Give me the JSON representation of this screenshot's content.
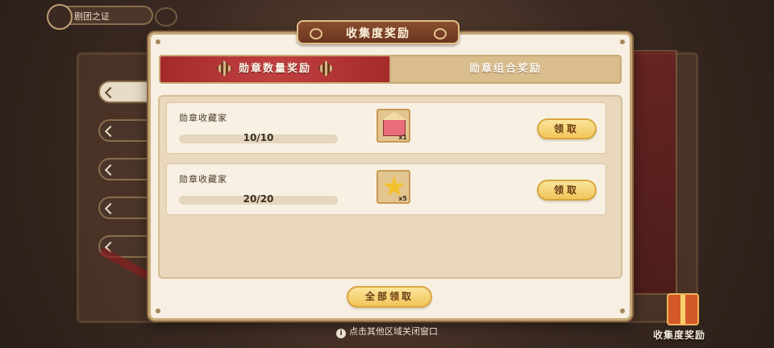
{
  "background": {
    "top_label": "剧团之证",
    "corner_reward_label": "收集度奖励",
    "hint": "点击其他区域关闭窗口"
  },
  "modal": {
    "title": "收集度奖励",
    "tabs": [
      {
        "label": "勋章数量奖励",
        "active": true
      },
      {
        "label": "勋章组合奖励",
        "active": false
      }
    ],
    "rows": [
      {
        "name": "勋章收藏家",
        "progress_text": "10/10",
        "progress_fraction": 1.0,
        "reward_icon": "collection-house-icon",
        "reward_count": "x1",
        "button": "领取"
      },
      {
        "name": "勋章收藏家",
        "progress_text": "20/20",
        "progress_fraction": 1.0,
        "reward_icon": "gold-star-icon",
        "reward_count": "x5",
        "button": "领取"
      }
    ],
    "claim_all": "全部领取"
  },
  "colors": {
    "active_tab": "#b53636",
    "button_gold": "#f2c559",
    "panel_cream": "#f7efe2"
  }
}
